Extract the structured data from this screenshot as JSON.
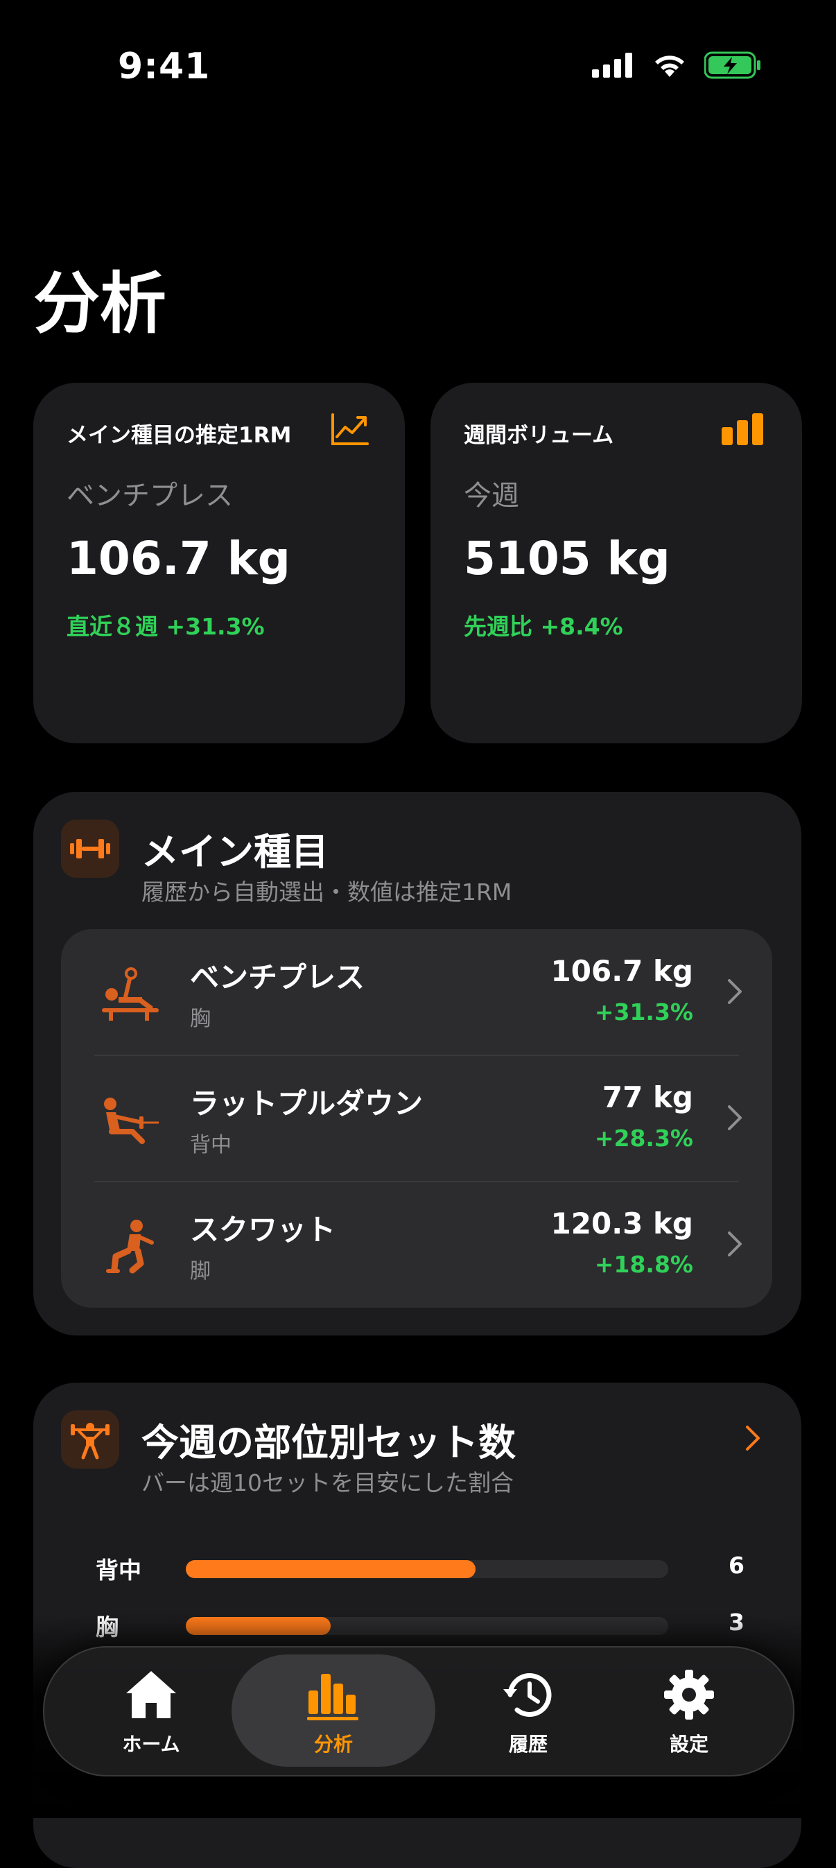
{
  "status_bar": {
    "time": "9:41"
  },
  "page": {
    "title": "分析"
  },
  "stat_cards": [
    {
      "label": "メイン種目の推定1RM",
      "sub": "ベンチプレス",
      "value": "106.7 kg",
      "change": "直近８週 +31.3%",
      "icon": "trend-chart-icon"
    },
    {
      "label": "週間ボリューム",
      "sub": "今週",
      "value": "5105 kg",
      "change": "先週比 +8.4%",
      "icon": "bar-chart-icon"
    }
  ],
  "main_exercises": {
    "title": "メイン種目",
    "subtitle": "履歴から自動選出・数値は推定1RM",
    "items": [
      {
        "name": "ベンチプレス",
        "part": "胸",
        "value": "106.7 kg",
        "change": "+31.3%",
        "icon": "bench-press-icon"
      },
      {
        "name": "ラットプルダウン",
        "part": "背中",
        "value": "77 kg",
        "change": "+28.3%",
        "icon": "rowing-icon"
      },
      {
        "name": "スクワット",
        "part": "脚",
        "value": "120.3 kg",
        "change": "+18.8%",
        "icon": "squat-icon"
      }
    ]
  },
  "weekly_sets": {
    "title": "今週の部位別セット数",
    "subtitle": "バーは週10セットを目安にした割合",
    "bars": [
      {
        "label": "背中",
        "count": "6",
        "ratio": 0.6
      },
      {
        "label": "胸",
        "count": "3",
        "ratio": 0.3
      }
    ]
  },
  "tab_bar": {
    "tabs": [
      {
        "label": "ホーム",
        "icon": "house-icon"
      },
      {
        "label": "分析",
        "icon": "analytics-icon",
        "active": true
      },
      {
        "label": "履歴",
        "icon": "history-icon"
      },
      {
        "label": "設定",
        "icon": "gear-icon"
      }
    ]
  },
  "colors": {
    "accent": "#ff9500",
    "positive": "#30d158",
    "card": "#1c1c1e"
  }
}
